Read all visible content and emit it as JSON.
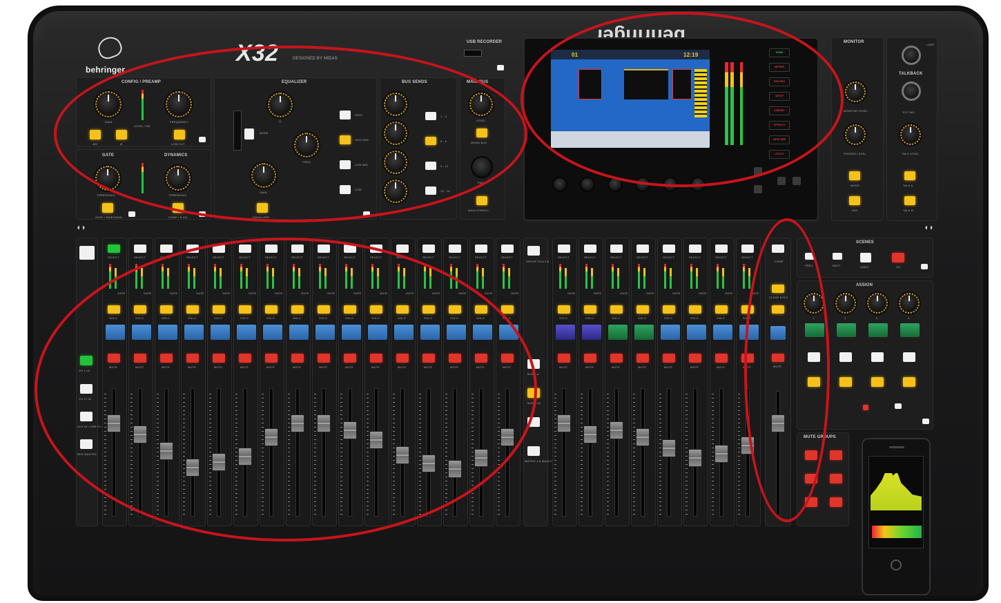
{
  "brand": {
    "name": "behringer",
    "model": "X32",
    "model_sub": "DESIGNED BY MIDAS",
    "top_logo_text": "behringer"
  },
  "sections": {
    "config_preamp": "CONFIG / PREAMP",
    "equalizer": "EQUALIZER",
    "bus_sends": "BUS SENDS",
    "main_bus": "MAIN BUS",
    "usb_recorder": "USB RECORDER",
    "gate": "GATE",
    "dynamics": "DYNAMICS",
    "monitor": "MONITOR",
    "talkback": "TALKBACK",
    "scenes": "SCENES",
    "assign": "ASSIGN",
    "mute_groups": "MUTE GROUPS"
  },
  "config_labels": {
    "gain": "GAIN",
    "frequency": "FREQUENCY",
    "level_db": "LEVEL / dB",
    "phantom": "48V",
    "phase": "Ø",
    "low_cut": "LOW CUT",
    "threshold": "THRESHOLD",
    "gate_sidechain": "GATE / SIDECHAIN",
    "comp_sidechain": "COMP / S-CH"
  },
  "eq_labels": {
    "mode": "MODE",
    "q": "Q",
    "freq": "FREQ",
    "gain": "GAIN",
    "high": "HIGH",
    "high_mid": "HIGH MID",
    "low_mid": "LOW MID",
    "low": "LOW",
    "eq_button": "EQUALIZER"
  },
  "bus_labels": [
    "1 - 4",
    "5 - 8",
    "9 - 12",
    "13 - 16"
  ],
  "main_bus_labels": {
    "mono_bus": "MONO BUS",
    "main_stereo": "MAIN STEREO",
    "level": "LEVEL",
    "pan": "PAN"
  },
  "view_buttons": [
    "HOME",
    "METERS",
    "ROUTING",
    "SETUP",
    "LIBRARY",
    "EFFECTS",
    "MUTE GRP",
    "UTILITY"
  ],
  "screen": {
    "channel": "01",
    "time": "12:19"
  },
  "channel_strip": {
    "select": "SELECT",
    "solo": "SOLO",
    "mute": "MUTE",
    "comp": "COMP",
    "gate": "GATE",
    "left_buttons": [
      "CH 1-16",
      "CH 17-32",
      "AUX IN / USB FX RETURN",
      "BUS MASTER"
    ],
    "group_buttons": [
      "GROUP DCA 1-8",
      "BUS 1-8",
      "BUS 9-16",
      "MATRIX 1-6 MAIN C"
    ],
    "clear_solo": "CLEAR SOLO",
    "solo_label": "SOLO"
  },
  "scenes_buttons": [
    "PREV",
    "NEXT",
    "UNDO",
    "GO"
  ],
  "assign_labels": [
    "1",
    "2",
    "3",
    "4"
  ],
  "monitor_labels": {
    "monitor_level": "MONITOR LEVEL",
    "phones_level": "PHONES LEVEL",
    "dim": "DIM",
    "mono": "MONO",
    "talk_a": "TALK A",
    "talk_b": "TALK B",
    "lamp": "LAMP",
    "ext_mic": "EXT MIC",
    "talk_level": "TALK LEVEL"
  },
  "colors": {
    "annotation": "#c8141b",
    "accent_yellow": "#f4c21a",
    "mute_red": "#e0352b",
    "select_green": "#22c23b"
  }
}
